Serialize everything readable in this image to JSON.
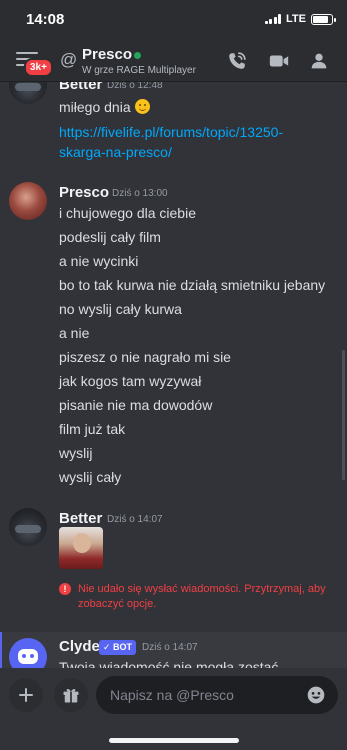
{
  "status_bar": {
    "time": "14:08",
    "network": "LTE",
    "battery_level": 0.85
  },
  "header": {
    "unread_badge": "3k+",
    "channel_name": "Presco",
    "status_text": "W grze RAGE Multiplayer",
    "online_color": "#23a55a",
    "icons": {
      "call": "phone-icon",
      "video": "video-camera-icon",
      "members": "members-icon"
    }
  },
  "messages": [
    {
      "author": "Better",
      "time": "Dziś o 12:48",
      "lines": [
        "miłego dnia",
        "https://fivelife.pl/forums/topic/13250-skarga-na-presco/"
      ]
    },
    {
      "author": "Presco",
      "time": "Dziś o 13:00",
      "lines": [
        "i chujowego dla ciebie",
        "podeslij cały film",
        "a nie wycinki",
        "bo to tak kurwa nie działą smietniku jebany",
        "no wyslij cały kurwa",
        "a nie",
        "piszesz o nie nagrało mi sie",
        "jak kogos tam wyzywał",
        "pisanie nie ma dowodów",
        "film już tak",
        "wyslij",
        "wyslij cały"
      ]
    },
    {
      "author": "Better",
      "time": "Dziś o 14:07",
      "error": "Nie udało się wysłać wiadomości. Przytrzymaj, aby zobaczyć opcje."
    },
    {
      "author": "Clyde",
      "bot_badge": "BOT",
      "time": "Dziś o 14:07",
      "text": "Twoja wiadomość nie mogła zostać"
    }
  ],
  "composer": {
    "placeholder": "Napisz na @Presco"
  },
  "colors": {
    "link": "#00a8fc",
    "error": "#f23f43",
    "accent": "#5865f2",
    "background": "#313338"
  }
}
